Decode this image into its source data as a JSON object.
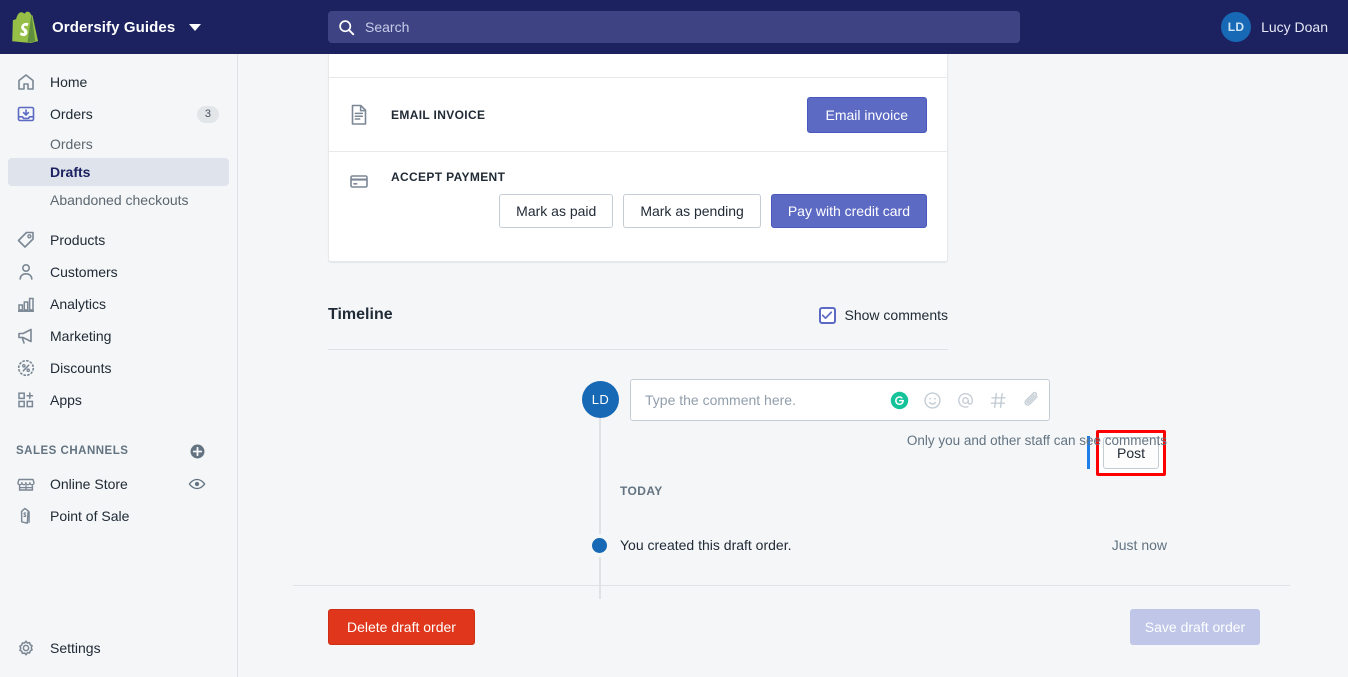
{
  "topbar": {
    "brand_name": "Ordersify Guides",
    "shopify_icon": "shopify-bag-icon",
    "caret_icon": "chevron-down-icon",
    "search": {
      "icon": "search-icon",
      "placeholder": "Search",
      "value": ""
    },
    "user": {
      "initials": "LD",
      "name": "Lucy Doan"
    },
    "background_color": "#1c2260",
    "search_background": "#3d4383"
  },
  "sidebar": {
    "items": [
      {
        "label": "Home",
        "icon": "home-icon",
        "badge": ""
      },
      {
        "label": "Orders",
        "icon": "orders-inbox-icon",
        "badge": "3"
      },
      {
        "label": "Products",
        "icon": "tag-icon",
        "badge": ""
      },
      {
        "label": "Customers",
        "icon": "person-icon",
        "badge": ""
      },
      {
        "label": "Analytics",
        "icon": "bar-chart-icon",
        "badge": ""
      },
      {
        "label": "Marketing",
        "icon": "megaphone-icon",
        "badge": ""
      },
      {
        "label": "Discounts",
        "icon": "percent-badge-icon",
        "badge": ""
      },
      {
        "label": "Apps",
        "icon": "apps-grid-plus-icon",
        "badge": ""
      }
    ],
    "orders_sub_items": [
      {
        "label": "Orders",
        "active": false
      },
      {
        "label": "Drafts",
        "active": true
      },
      {
        "label": "Abandoned checkouts",
        "active": false
      }
    ],
    "sales_channels": {
      "title": "SALES CHANNELS",
      "add_icon": "plus-circle-icon",
      "items": [
        {
          "label": "Online Store",
          "icon": "storefront-icon",
          "trailing_icon": "eye-icon"
        },
        {
          "label": "Point of Sale",
          "icon": "pos-bag-icon",
          "trailing_icon": ""
        }
      ]
    },
    "settings": {
      "label": "Settings",
      "icon": "gear-icon"
    },
    "active_item": "Drafts"
  },
  "payment_card": {
    "email_invoice": {
      "icon": "document-invoice-icon",
      "label": "EMAIL INVOICE",
      "button": "Email invoice"
    },
    "accept_payment": {
      "icon": "credit-card-icon",
      "label": "ACCEPT PAYMENT",
      "buttons": [
        {
          "label": "Mark as paid",
          "style": "secondary"
        },
        {
          "label": "Mark as pending",
          "style": "secondary"
        },
        {
          "label": "Pay with credit card",
          "style": "primary"
        }
      ]
    }
  },
  "timeline": {
    "title": "Timeline",
    "show_comments": {
      "label": "Show comments",
      "checked": true,
      "check_icon": "check-icon"
    },
    "comment_input": {
      "avatar_initials": "LD",
      "placeholder": "Type the comment here.",
      "value": "",
      "icons": [
        "grammarly-icon",
        "emoji-smiley-icon",
        "mention-at-icon",
        "hashtag-icon",
        "paperclip-attachment-icon"
      ],
      "post_button": "Post",
      "post_button_highlighted": true,
      "highlight_color": "#ff0000"
    },
    "privacy_note": "Only you and other staff can see comments",
    "day_label": "TODAY",
    "events": [
      {
        "text": "You created this draft order.",
        "time": "Just now"
      }
    ]
  },
  "footer": {
    "delete_button": "Delete draft order",
    "save_button": "Save draft order",
    "save_disabled": true,
    "delete_color": "#e0361b",
    "save_color": "#bfc6e8"
  }
}
